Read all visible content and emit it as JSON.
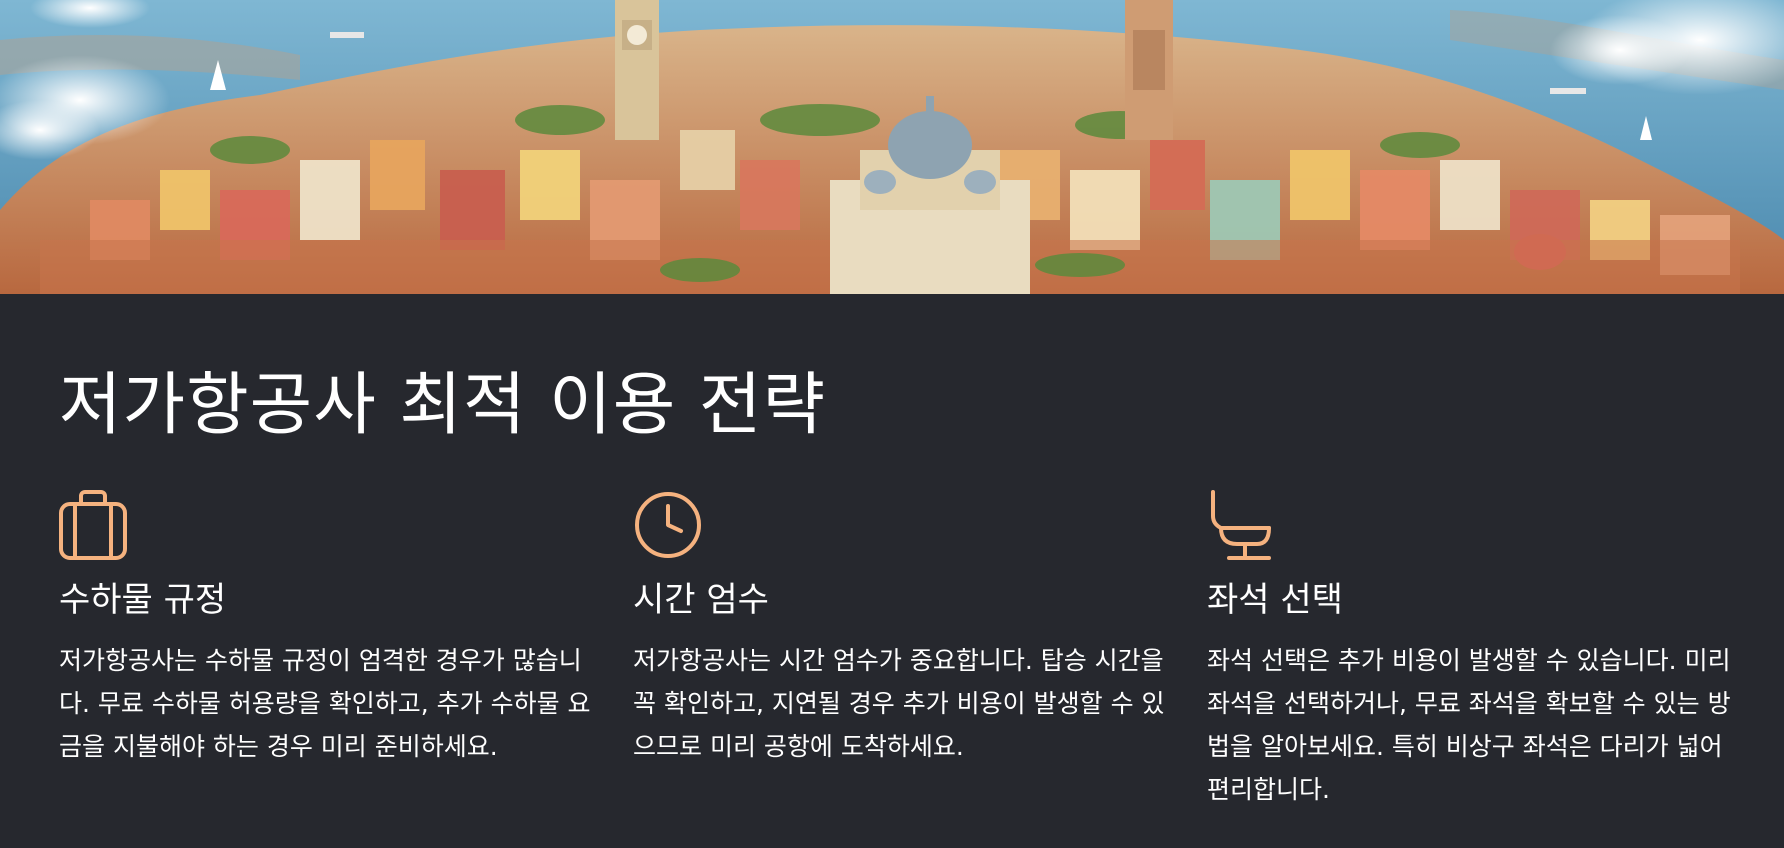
{
  "hero": {
    "image": "aerial-coastal-city-illustration"
  },
  "section": {
    "title": "저가항공사 최적 이용 전략"
  },
  "accent_color": "#f5b27f",
  "background_color": "#26282e",
  "features": [
    {
      "icon": "luggage-icon",
      "heading": "수하물 규정",
      "description": "저가항공사는 수하물 규정이 엄격한 경우가 많습니다. 무료 수하물 허용량을 확인하고, 추가 수하물 요금을 지불해야 하는 경우 미리 준비하세요."
    },
    {
      "icon": "clock-icon",
      "heading": "시간 엄수",
      "description": "저가항공사는 시간 엄수가 중요합니다. 탑승 시간을 꼭 확인하고, 지연될 경우 추가 비용이 발생할 수 있으므로 미리 공항에 도착하세요."
    },
    {
      "icon": "seat-icon",
      "heading": "좌석 선택",
      "description": "좌석 선택은 추가 비용이 발생할 수 있습니다. 미리 좌석을 선택하거나, 무료 좌석을 확보할 수 있는 방법을 알아보세요. 특히 비상구 좌석은 다리가 넓어 편리합니다."
    }
  ]
}
